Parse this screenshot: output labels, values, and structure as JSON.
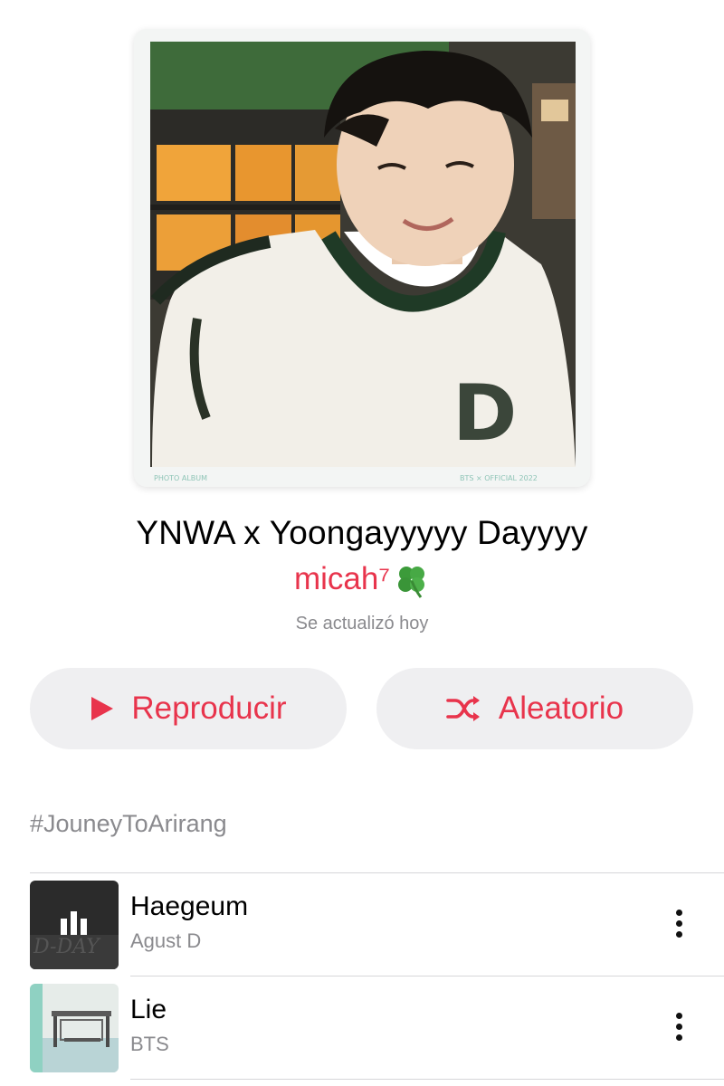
{
  "playlist": {
    "title": "YNWA x Yoongayyyyy Dayyyy",
    "curator": "micah⁷",
    "curator_icon": "four-leaf-clover-icon",
    "updated": "Se actualizó hoy",
    "description": "#JouneyToArirang"
  },
  "artwork": {
    "left_caption": "PHOTO ALBUM",
    "right_caption": "BTS × OFFICIAL 2022",
    "shirt_letter": "D"
  },
  "actions": {
    "play_label": "Reproducir",
    "play_icon": "play-icon",
    "shuffle_label": "Aleatorio",
    "shuffle_icon": "shuffle-icon"
  },
  "tracks": [
    {
      "title": "Haegeum",
      "artist": "Agust D",
      "art_icon": "album-art-d-day",
      "more_icon": "more-vertical-icon"
    },
    {
      "title": "Lie",
      "artist": "BTS",
      "art_icon": "album-art-bus-stop",
      "more_icon": "more-vertical-icon"
    }
  ],
  "colors": {
    "accent": "#e8344c",
    "secondary_text": "#8a8a8e",
    "button_bg": "#efeff1",
    "divider": "#d6d6d9"
  }
}
